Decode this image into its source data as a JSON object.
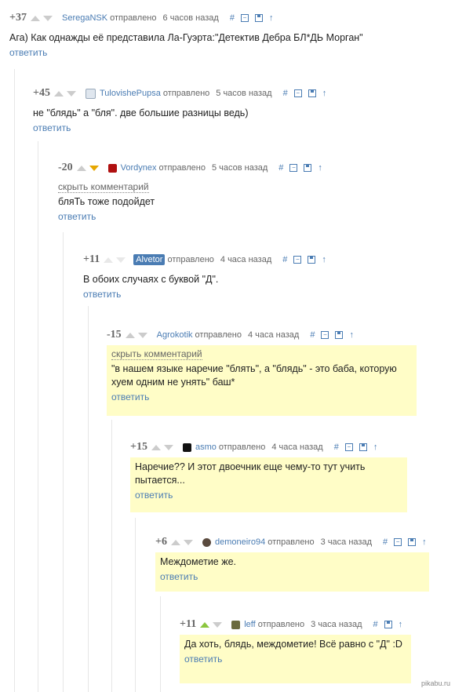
{
  "comments": [
    {
      "rating": "+37",
      "author": "SeregaNSK",
      "sent": "отправлено",
      "time": "6 часов назад",
      "text": "Ага) Как однажды её представила Ла-Гуэрта:\"Детектив Дебра БЛ*ДЬ Морган\"",
      "reply": "ответить"
    },
    {
      "rating": "+45",
      "author": "TulovishePupsa",
      "sent": "отправлено",
      "time": "5 часов назад",
      "text": "не \"блядь\" а \"бля\". две большие разницы ведь)",
      "reply": "ответить"
    },
    {
      "rating": "-20",
      "author": "Vordynex",
      "sent": "отправлено",
      "time": "5 часов назад",
      "hide": "скрыть комментарий",
      "text": "бляТь тоже подойдет",
      "reply": "ответить"
    },
    {
      "rating": "+11",
      "author": "Alvetor",
      "sent": "отправлено",
      "time": "4 часа назад",
      "text": "В обоих случаях с буквой \"Д\".",
      "reply": "ответить"
    },
    {
      "rating": "-15",
      "author": "Agrokotik",
      "sent": "отправлено",
      "time": "4 часа назад",
      "hide": "скрыть комментарий",
      "text": "\"в нашем языке наречие \"блять\", а \"блядь\" - это баба, которую хуем одним не унять\" баш*",
      "reply": "ответить"
    },
    {
      "rating": "+15",
      "author": "asmo",
      "sent": "отправлено",
      "time": "4 часа назад",
      "text": "Наречие?? И этот двоечник еще чему-то тут учить пытается...",
      "reply": "ответить"
    },
    {
      "rating": "+6",
      "author": "demoneiro94",
      "sent": "отправлено",
      "time": "3 часа назад",
      "text": "Междометие же.",
      "reply": "ответить"
    },
    {
      "rating": "+11",
      "author": "leff",
      "sent": "отправлено",
      "time": "3 часа назад",
      "text": "Да хоть, блядь, междометие! Всё равно с \"Д\" :D",
      "reply": "ответить"
    }
  ],
  "icons": {
    "link": "#",
    "collapse": "collapse-icon",
    "save": "save-icon",
    "parent": "↑"
  },
  "watermark": "pikabu.ru",
  "colors": {
    "link": "#4a7cb3",
    "highlight": "#fffdc7",
    "upvote_active": "#8cc63f",
    "downvote_active": "#e6a700"
  }
}
